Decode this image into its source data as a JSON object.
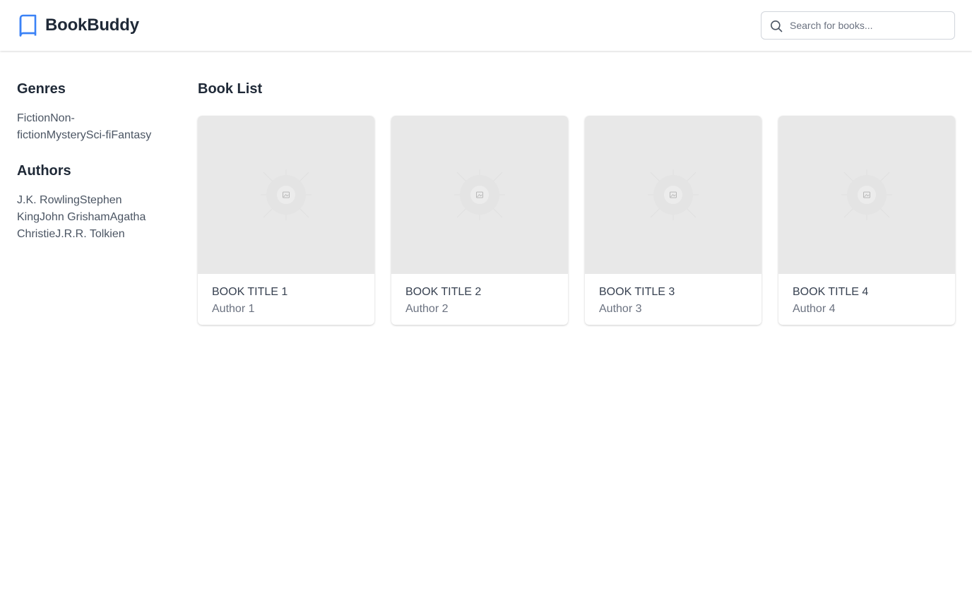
{
  "header": {
    "brand_name": "BookBuddy",
    "brand_icon": "book-icon",
    "search": {
      "placeholder": "Search for books...",
      "value": ""
    },
    "accent_color": "#3b82f6"
  },
  "sidebar": {
    "genres": {
      "heading": "Genres",
      "items": [
        "Fiction",
        "Non-fiction",
        "Mystery",
        "Sci-fi",
        "Fantasy"
      ]
    },
    "authors": {
      "heading": "Authors",
      "items": [
        "J.K. Rowling",
        "Stephen King",
        "John Grisham",
        "Agatha Christie",
        "J.R.R. Tolkien"
      ]
    }
  },
  "main": {
    "heading": "Book List",
    "books": [
      {
        "title": "Book Title 1",
        "author": "Author 1",
        "cover_icon": "image-placeholder-icon"
      },
      {
        "title": "Book Title 2",
        "author": "Author 2",
        "cover_icon": "image-placeholder-icon"
      },
      {
        "title": "Book Title 3",
        "author": "Author 3",
        "cover_icon": "image-placeholder-icon"
      },
      {
        "title": "Book Title 4",
        "author": "Author 4",
        "cover_icon": "image-placeholder-icon"
      }
    ]
  }
}
